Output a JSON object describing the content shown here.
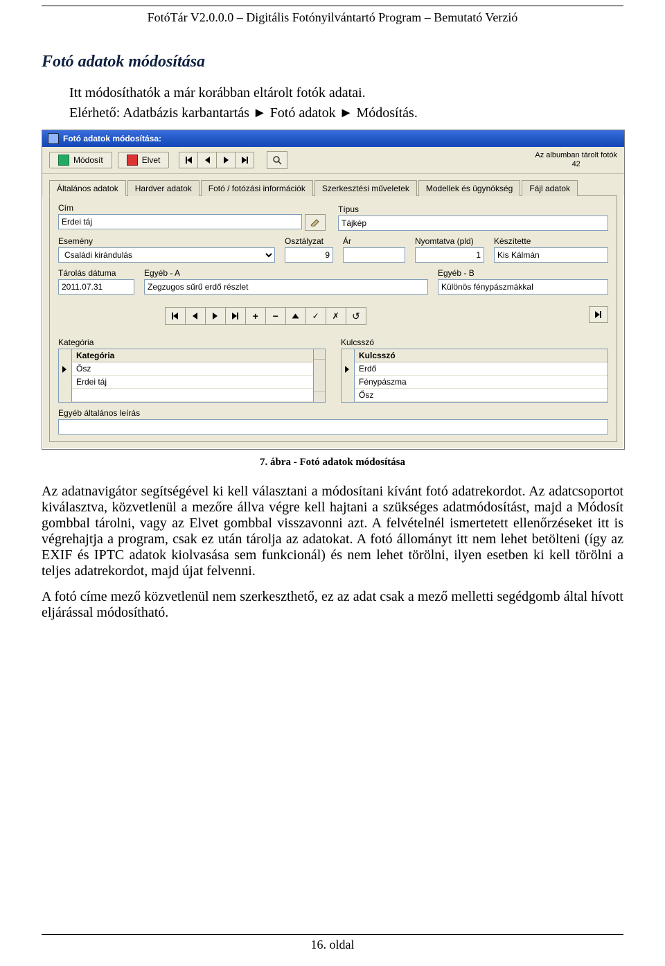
{
  "doc": {
    "header": "FotóTár V2.0.0.0 – Digitális Fotónyilvántartó Program – Bemutató Verzió",
    "section_title": "Fotó adatok módosítása",
    "intro1": "Itt módosíthatók a már korábban eltárolt fotók adatai.",
    "intro2": "Elérhető: Adatbázis karbantartás ► Fotó adatok ► Módosítás.",
    "caption": "7. ábra - Fotó adatok módosítása",
    "para1": "Az adatnavigátor segítségével ki kell választani a módosítani kívánt fotó adatrekordot. Az adatcsoportot kiválasztva, közvetlenül a mezőre állva végre kell hajtani a szükséges adatmódosítást, majd a Módosít gombbal tárolni, vagy az Elvet gombbal visszavonni azt. A felvételnél ismertetett ellenőrzéseket itt is végrehajtja a program, csak ez után tárolja az adatokat. A fotó állományt itt nem lehet betölteni (így az EXIF és IPTC adatok kiolvasása sem funkcionál) és nem lehet törölni, ilyen esetben ki kell törölni a teljes adatrekordot, majd újat felvenni.",
    "para2": "A fotó címe mező közvetlenül nem szerkeszthető, ez az adat csak a mező melletti segédgomb által hívott eljárással módosítható.",
    "footer": "16. oldal"
  },
  "ui": {
    "title": "Fotó adatok módosítása:",
    "btn_modify": "Módosít",
    "btn_cancel": "Elvet",
    "counter_label": "Az albumban tárolt fotók",
    "counter_value": "42",
    "tabs": [
      "Általános adatok",
      "Hardver adatok",
      "Fotó / fotózási információk",
      "Szerkesztési műveletek",
      "Modellek és ügynökség",
      "Fájl adatok"
    ],
    "labels": {
      "cim": "Cím",
      "tipus": "Típus",
      "esemeny": "Esemény",
      "osztalyzat": "Osztályzat",
      "ar": "Ár",
      "nyomtatva": "Nyomtatva (pld)",
      "keszitette": "Készítette",
      "tarolas": "Tárolás dátuma",
      "egyebA": "Egyéb - A",
      "egyebB": "Egyéb - B",
      "kategoria": "Kategória",
      "kulcsszo": "Kulcsszó",
      "leiras": "Egyéb általános leírás"
    },
    "values": {
      "cim": "Erdei táj",
      "tipus": "Tájkép",
      "esemeny": "Családi kirándulás",
      "osztalyzat": "9",
      "ar": "",
      "nyomtatva": "1",
      "keszitette": "Kis Kálmán",
      "tarolas": "2011.07.31",
      "egyebA": "Zegzugos sűrű erdő részlet",
      "egyebB": "Különös fénypászmákkal"
    },
    "grid_kategoria": {
      "header": "Kategória",
      "rows": [
        "Ősz",
        "Erdei táj"
      ]
    },
    "grid_kulcsszo": {
      "header": "Kulcsszó",
      "rows": [
        "Erdő",
        "Fénypászma",
        "Ősz"
      ]
    }
  }
}
